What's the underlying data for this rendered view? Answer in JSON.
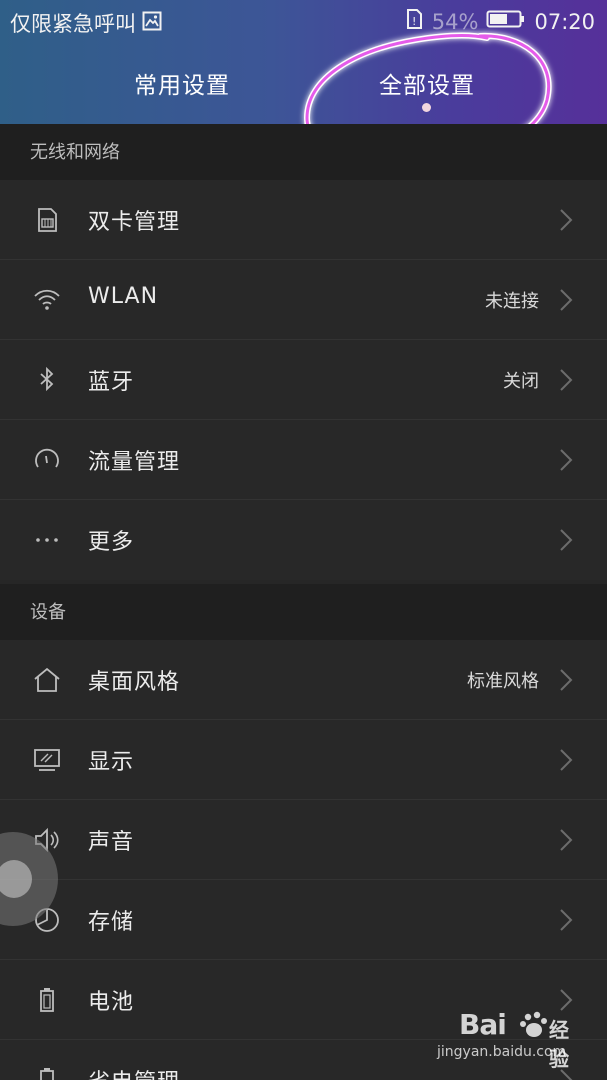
{
  "status_bar": {
    "left_text": "仅限紧急呼叫",
    "battery_percent": "54%",
    "time": "07:20"
  },
  "tabs": {
    "common": "常用设置",
    "all": "全部设置"
  },
  "sections": [
    {
      "title": "无线和网络",
      "items": [
        {
          "label": "双卡管理",
          "value": "",
          "icon": "sim-card-icon"
        },
        {
          "label": "WLAN",
          "value": "未连接",
          "icon": "wifi-icon"
        },
        {
          "label": "蓝牙",
          "value": "关闭",
          "icon": "bluetooth-icon"
        },
        {
          "label": "流量管理",
          "value": "",
          "icon": "data-gauge-icon"
        },
        {
          "label": "更多",
          "value": "",
          "icon": "more-dots-icon"
        }
      ]
    },
    {
      "title": "设备",
      "items": [
        {
          "label": "桌面风格",
          "value": "标准风格",
          "icon": "home-icon"
        },
        {
          "label": "显示",
          "value": "",
          "icon": "display-icon"
        },
        {
          "label": "声音",
          "value": "",
          "icon": "speaker-icon"
        },
        {
          "label": "存储",
          "value": "",
          "icon": "storage-pie-icon"
        },
        {
          "label": "电池",
          "value": "",
          "icon": "battery-icon"
        },
        {
          "label": "省电管理",
          "value": "",
          "icon": "power-save-icon"
        }
      ]
    }
  ],
  "watermark": {
    "brand_prefix": "Bai",
    "brand_suffix": "经验",
    "url": "jingyan.baidu.com"
  },
  "colors": {
    "annotation_stroke": "#e040e6",
    "header_gradient_start": "#2f5f88",
    "header_gradient_end": "#56309a",
    "background": "#262626"
  }
}
